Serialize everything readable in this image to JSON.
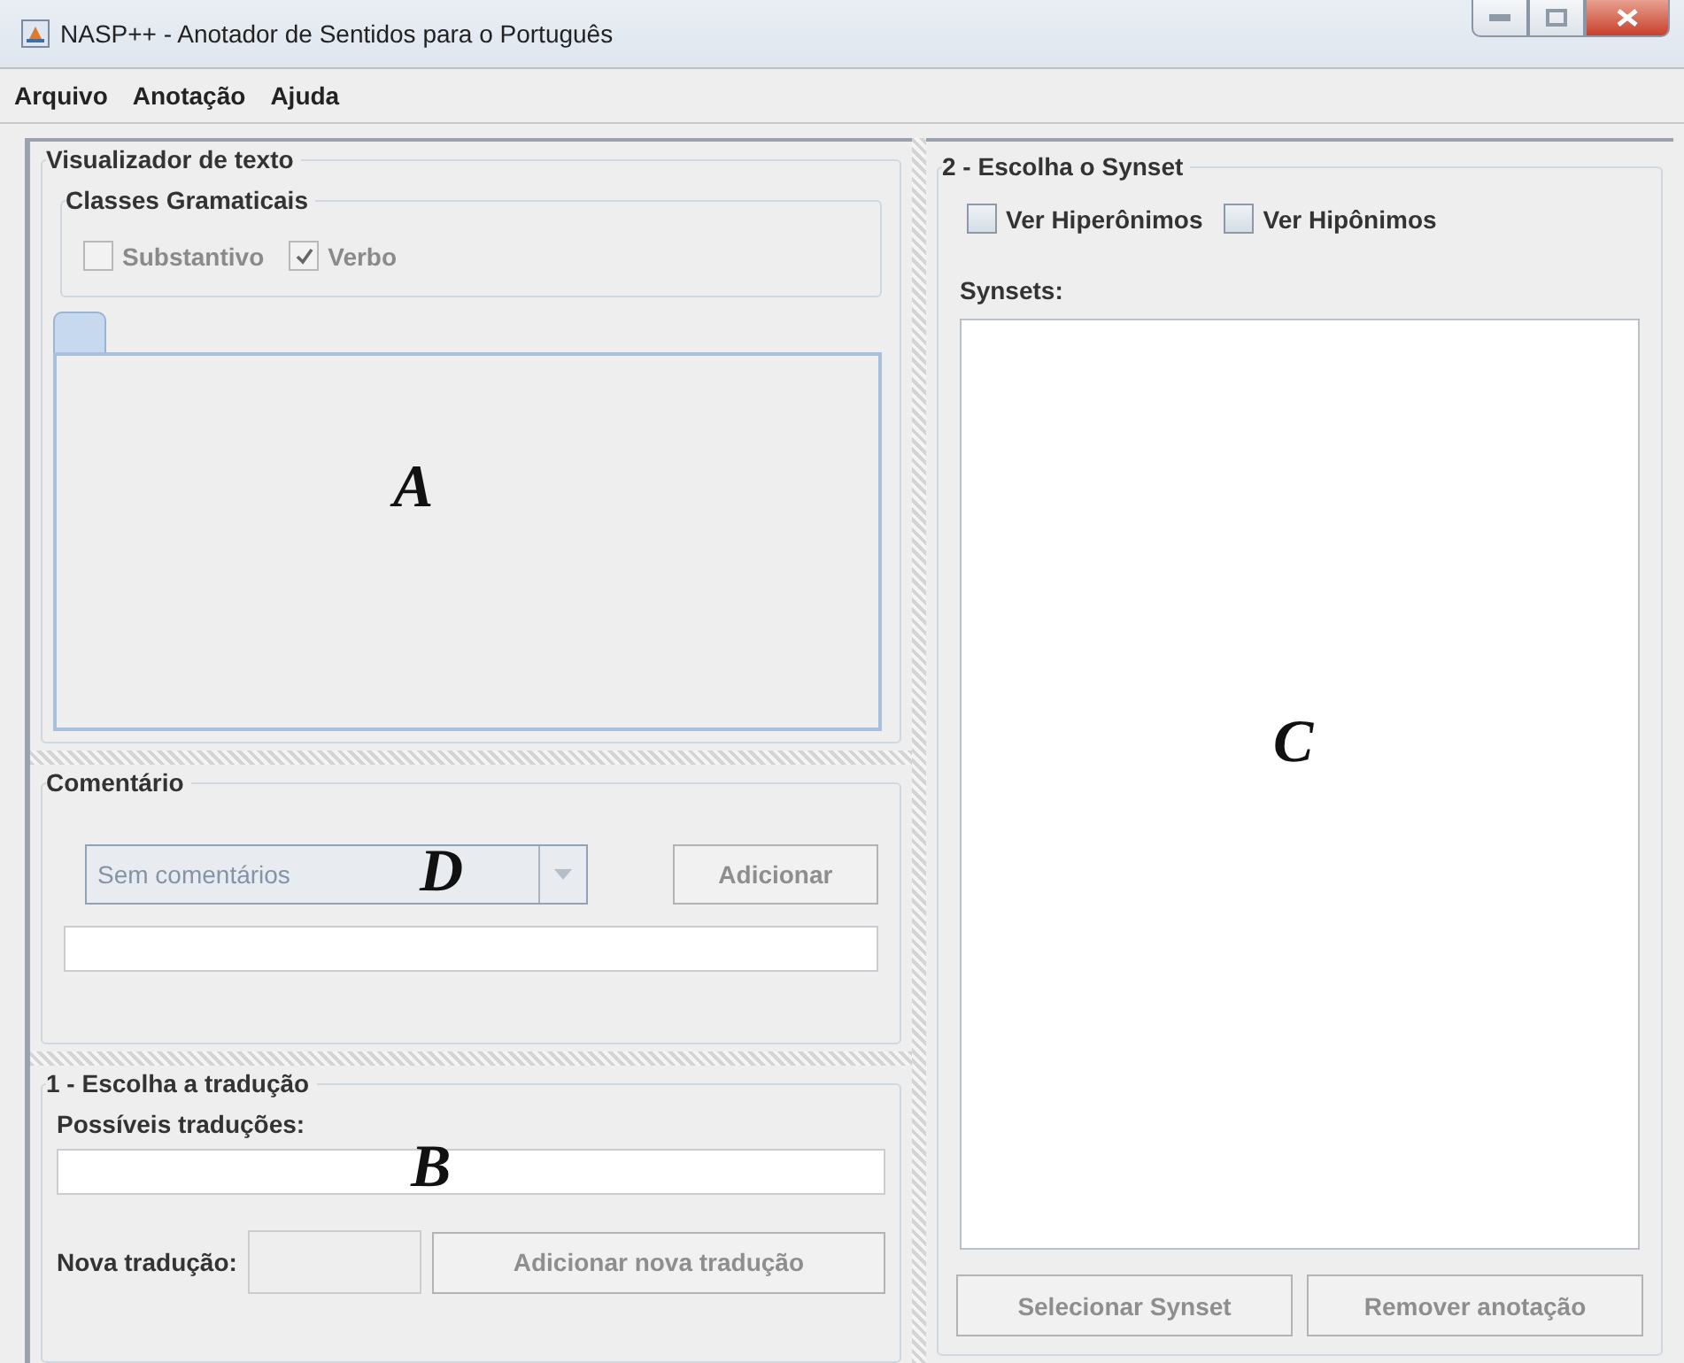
{
  "window": {
    "title": "NASP++ - Anotador de Sentidos para o Português"
  },
  "menu": [
    "Arquivo",
    "Anotação",
    "Ajuda"
  ],
  "viewer": {
    "title": "Visualizador de texto",
    "classes_title": "Classes Gramaticais",
    "classes": [
      {
        "label": "Substantivo",
        "checked": false,
        "disabled": true
      },
      {
        "label": "Verbo",
        "checked": true,
        "disabled": true
      }
    ],
    "marker": "A"
  },
  "comment": {
    "title": "Comentário",
    "combo": {
      "value": "Sem comentários",
      "disabled": true
    },
    "add_button": {
      "label": "Adicionar",
      "disabled": true
    },
    "marker": "D"
  },
  "translation": {
    "title": "1 - Escolha a tradução",
    "possible_label": "Possíveis traduções:",
    "new_label": "Nova tradução:",
    "add_button": {
      "label": "Adicionar nova tradução",
      "disabled": true
    },
    "marker": "B"
  },
  "synset": {
    "title": "2 - Escolha o Synset",
    "options": [
      {
        "label": "Ver Hiperônimos",
        "checked": false
      },
      {
        "label": "Ver Hipônimos",
        "checked": false
      }
    ],
    "list_label": "Synsets:",
    "marker": "C",
    "buttons": [
      {
        "label": "Selecionar Synset",
        "disabled": true
      },
      {
        "label": "Remover anotação",
        "disabled": true
      }
    ]
  }
}
